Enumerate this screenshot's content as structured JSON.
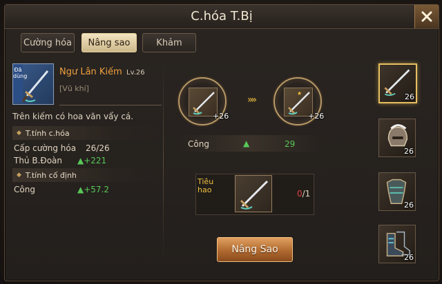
{
  "window": {
    "title": "C.hóa T.Bị"
  },
  "tabs": [
    {
      "label": "Cường hóa",
      "active": false
    },
    {
      "label": "Nâng sao",
      "active": true
    },
    {
      "label": "Khảm",
      "active": false
    }
  ],
  "item": {
    "badge": "Đã dùng",
    "name": "Ngư Lân Kiếm",
    "level": "Lv.26",
    "type": "[Vũ khí]",
    "description": "Trên kiếm có hoa văn vẩy cá."
  },
  "enhance_section": {
    "header": "T.tính c.hóa",
    "rows": [
      {
        "label": "Cấp cường hóa",
        "value": "26/26",
        "arrow": false
      },
      {
        "label": "Thủ B.Đoàn",
        "value": "+221",
        "arrow": true
      }
    ]
  },
  "fixed_section": {
    "header": "T.tính cố định",
    "rows": [
      {
        "label": "Công",
        "value": "+57.2",
        "arrow": true
      }
    ]
  },
  "upgrade": {
    "current_count": "+26",
    "next_count": "+26",
    "stat_label": "Công",
    "stat_value": "29"
  },
  "cost": {
    "label": "Tiêu hao",
    "have": "0",
    "need": "/1"
  },
  "action_button": "Nâng Sao",
  "equipment_slots": [
    {
      "icon": "sword-icon",
      "count": "26",
      "selected": true
    },
    {
      "icon": "helmet-icon",
      "count": "26",
      "selected": false
    },
    {
      "icon": "armor-icon",
      "count": "26",
      "selected": false
    },
    {
      "icon": "boots-icon",
      "count": "26",
      "selected": false
    }
  ],
  "colors": {
    "accent_gold": "#f0c040",
    "item_name": "#f0a040",
    "increase_green": "#58c858",
    "cost_red": "#e04040"
  }
}
